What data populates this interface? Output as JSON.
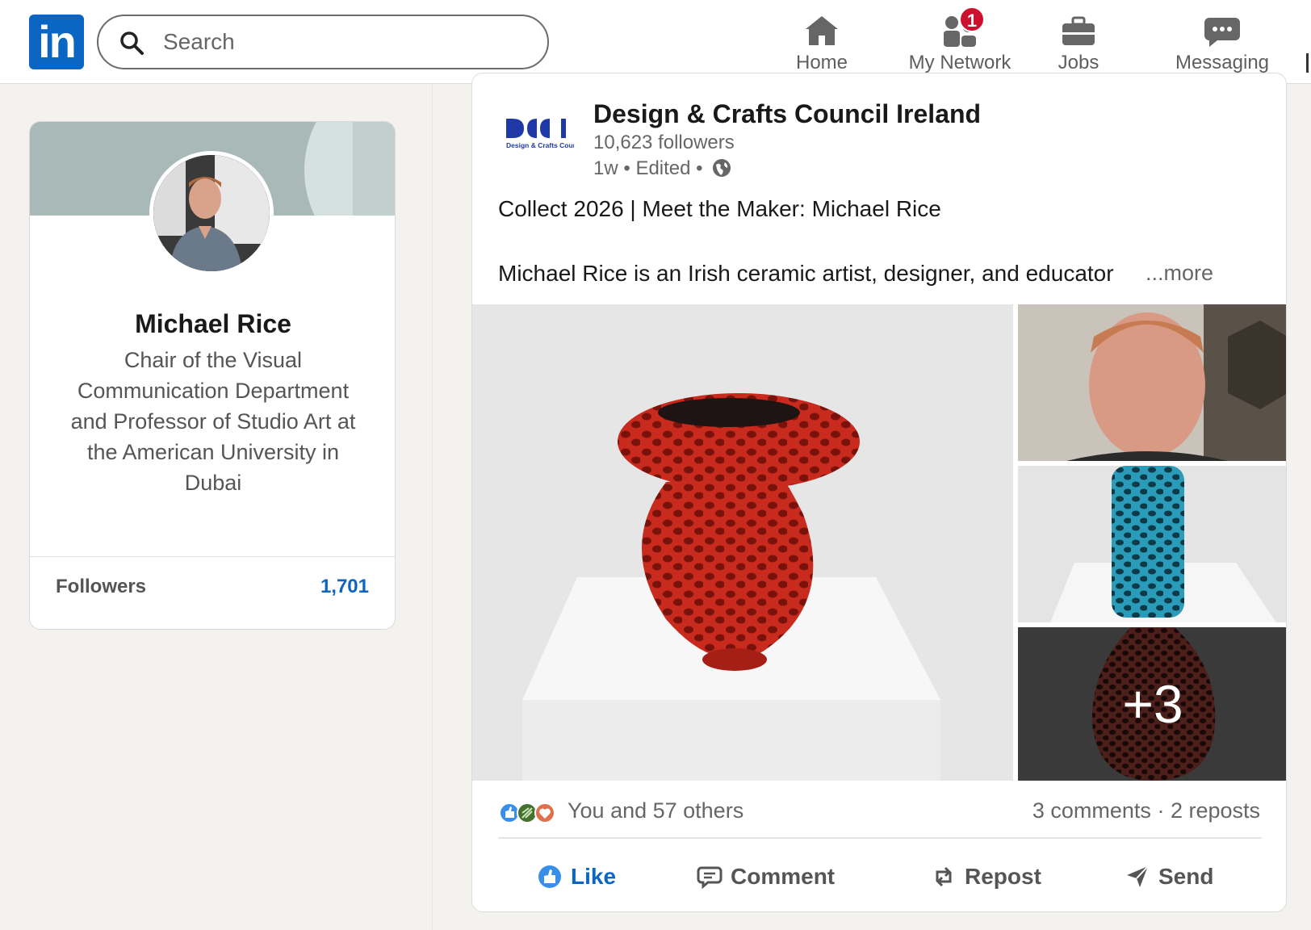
{
  "app": {
    "logo_text": "in",
    "brand_color": "#0a66c2"
  },
  "search": {
    "placeholder": "Search"
  },
  "nav": {
    "home": "Home",
    "network": "My Network",
    "network_badge": "1",
    "jobs": "Jobs",
    "messaging": "Messaging"
  },
  "profile": {
    "name": "Michael Rice",
    "headline": "Chair of the Visual Communication Department and Professor of Studio Art at the American University in Dubai",
    "followers_label": "Followers",
    "followers_count": "1,701"
  },
  "post": {
    "org_name": "Design & Crafts Council Ireland",
    "org_logo_text": "Design & Crafts Council Ireland",
    "org_followers": "10,623 followers",
    "time": "1w",
    "edited": "Edited",
    "title": "Collect 2026 | Meet the Maker: Michael Rice",
    "body": "Michael Rice is an Irish ceramic artist, designer, and educator",
    "more": "...more",
    "more_images": "+3",
    "reactions_text": "You and 57 others",
    "comments": "3 comments",
    "reposts": "2 reposts",
    "actions": {
      "like": "Like",
      "comment": "Comment",
      "repost": "Repost",
      "send": "Send"
    }
  }
}
